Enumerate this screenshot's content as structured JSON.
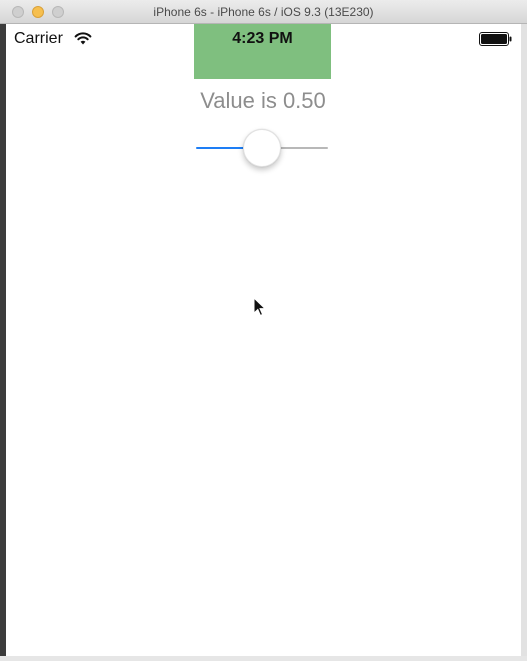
{
  "window": {
    "title": "iPhone 6s - iPhone 6s / iOS 9.3 (13E230)",
    "buttons": [
      "close-button",
      "minimize-button",
      "zoom-button"
    ]
  },
  "status_bar": {
    "carrier": "Carrier",
    "time": "4:23 PM",
    "icons": [
      "wifi-icon",
      "battery-icon"
    ]
  },
  "content": {
    "value_label": "Value is 0.50",
    "slider": {
      "value": 0.5,
      "min": 0,
      "max": 1
    }
  },
  "colors": {
    "time_background": "#7fbf7f",
    "slider_min_track": "#1e7ef5",
    "slider_max_track": "#b8b8b8",
    "label_text": "#8d8d8d"
  },
  "cursor": "arrow-cursor-icon"
}
